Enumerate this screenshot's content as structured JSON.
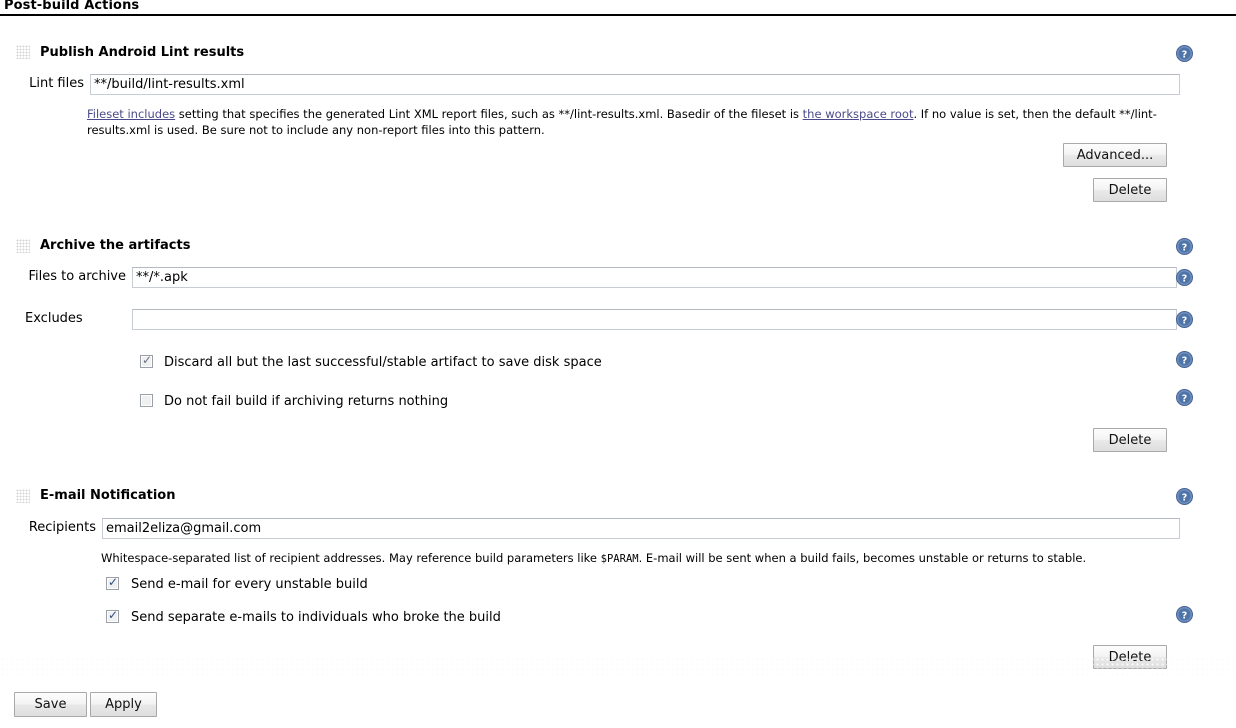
{
  "page": {
    "title": "Post-build Actions"
  },
  "sections": [
    {
      "heading": "Publish Android Lint results",
      "fields": [
        {
          "label": "Lint files",
          "value": "**/build/lint-results.xml",
          "placeholder": ""
        }
      ],
      "description": {
        "link1": "Fileset includes",
        "part1": " setting that specifies the generated Lint XML report files, such as **/lint-results.xml. Basedir of the fileset is ",
        "link2": "the workspace root",
        "part2": ". If no value is set, then the default **/lint-results.xml is used. Be sure not to include any non-report files into this pattern."
      },
      "buttons": {
        "advanced": "Advanced...",
        "delete": "Delete"
      }
    },
    {
      "heading": "Archive the artifacts",
      "fields": [
        {
          "label": "Files to archive",
          "value": "**/*.apk",
          "placeholder": ""
        },
        {
          "label": "Excludes",
          "value": "",
          "placeholder": ""
        }
      ],
      "checkboxes": [
        {
          "label": "Discard all but the last successful/stable artifact to save disk space",
          "checked": true,
          "style": "gray"
        },
        {
          "label": "Do not fail build if archiving returns nothing",
          "checked": false,
          "style": "none"
        }
      ],
      "buttons": {
        "delete": "Delete"
      }
    },
    {
      "heading": "E-mail Notification",
      "fields": [
        {
          "label": "Recipients",
          "value": "email2eliza@gmail.com",
          "placeholder": ""
        }
      ],
      "description": {
        "part1": "Whitespace-separated list of recipient addresses. May reference build parameters like ",
        "mono": "$PARAM",
        "part2": ". E-mail will be sent when a build fails, becomes unstable or returns to stable."
      },
      "checkboxes": [
        {
          "label": "Send e-mail for every unstable build",
          "checked": true,
          "style": "blue"
        },
        {
          "label": "Send separate e-mails to individuals who broke the build",
          "checked": true,
          "style": "blue"
        }
      ],
      "buttons": {
        "delete": "Delete"
      }
    }
  ],
  "footer": {
    "save": "Save",
    "apply": "Apply"
  },
  "icons": {
    "help": "help-icon",
    "drag": "drag-handle-icon"
  },
  "colors": {
    "help_blue": "#5f83b9",
    "help_blue_dark": "#3c5f96",
    "link": "#4a4a8a",
    "rule": "#000000"
  }
}
